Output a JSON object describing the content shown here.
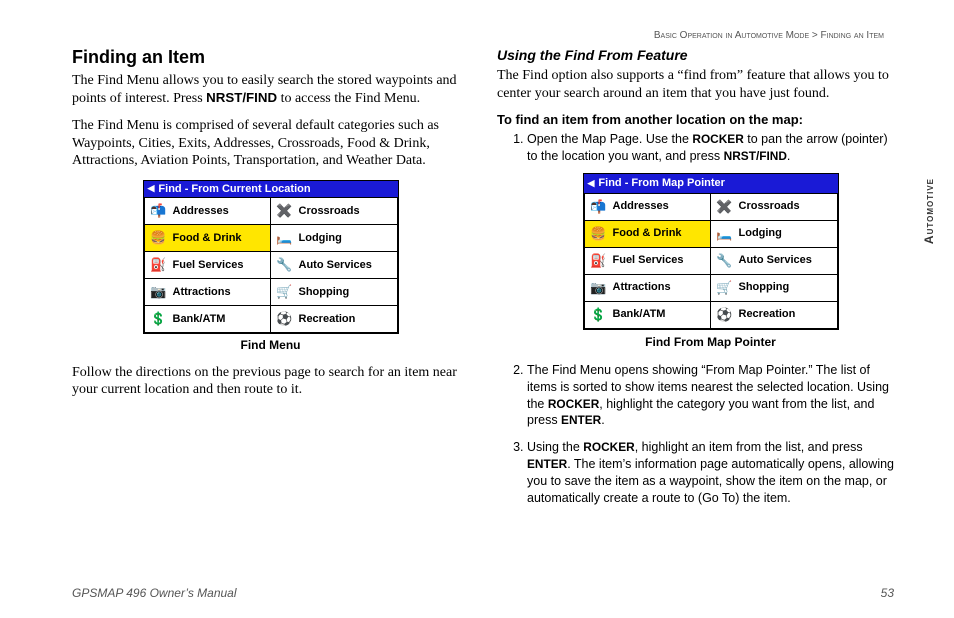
{
  "breadcrumb": {
    "a": "Basic Operation in Automotive Mode",
    "sep": " > ",
    "b": "Finding an Item"
  },
  "left": {
    "h1": "Finding an Item",
    "p1a": "The Find Menu allows you to easily search the stored waypoints and points of interest. Press ",
    "p1b": "NRST/FIND",
    "p1c": " to access the Find Menu.",
    "p2": "The Find Menu is comprised of several default categories such as Waypoints, Cities, Exits, Addresses, Crossroads, Food & Drink, Attractions, Aviation Points, Transportation, and Weather Data.",
    "caption": "Find Menu",
    "p3": "Follow the directions on the previous page to search for an item near your current location and then route to it."
  },
  "right": {
    "h2": "Using the Find From Feature",
    "p1": "The Find option also supports a “find from” feature that allows you to center your search around an item that you have just found.",
    "h3": "To find an item from another location on the map:",
    "step1a": "Open the Map Page. Use the ",
    "step1b": "ROCKER",
    "step1c": " to pan the arrow (pointer) to the location you want, and press ",
    "step1d": "NRST/FIND",
    "step1e": ".",
    "caption": "Find From Map Pointer",
    "step2a": "The Find Menu opens showing “From Map Pointer.” The list of items is sorted to show items nearest the selected location. Using the ",
    "step2b": "ROCKER",
    "step2c": ", highlight the category you want from the list, and press ",
    "step2d": "ENTER",
    "step2e": ".",
    "step3a": "Using the ",
    "step3b": "ROCKER",
    "step3c": ", highlight an item from the list, and press ",
    "step3d": "ENTER",
    "step3e": ". The item’s information page automatically opens, allowing you to save the item as a waypoint, show the item on the map, or automatically create a route to (Go To) the item."
  },
  "gps1": {
    "title": "Find - From Current Location",
    "cells": [
      "Addresses",
      "Crossroads",
      "Food & Drink",
      "Lodging",
      "Fuel Services",
      "Auto Services",
      "Attractions",
      "Shopping",
      "Bank/ATM",
      "Recreation"
    ]
  },
  "gps2": {
    "title": "Find - From Map Pointer",
    "cells": [
      "Addresses",
      "Crossroads",
      "Food & Drink",
      "Lodging",
      "Fuel Services",
      "Auto Services",
      "Attractions",
      "Shopping",
      "Bank/ATM",
      "Recreation"
    ]
  },
  "sideTab": "Automotive",
  "footer": {
    "left": "GPSMAP 496 Owner’s Manual",
    "right": "53"
  }
}
